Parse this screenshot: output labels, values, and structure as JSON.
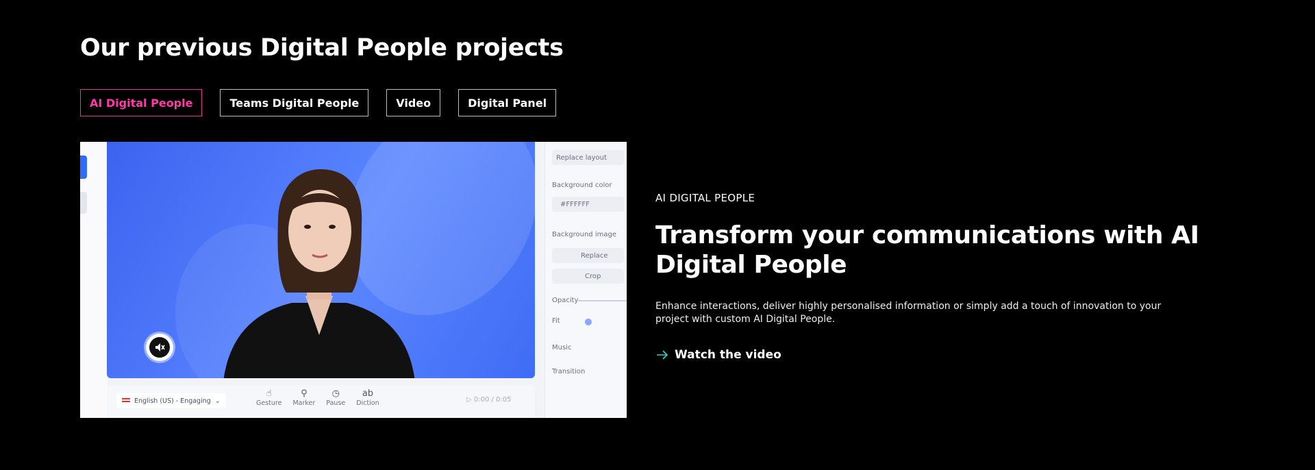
{
  "section": {
    "title": "Our previous Digital People projects"
  },
  "tabs": [
    {
      "label": "AI Digital People",
      "active": true
    },
    {
      "label": "Teams Digital People",
      "active": false
    },
    {
      "label": "Video",
      "active": false
    },
    {
      "label": "Digital Panel",
      "active": false
    }
  ],
  "media": {
    "side_panel": {
      "replace_layout": "Replace layout",
      "background_color_label": "Background color",
      "background_color_value": "#FFFFFF",
      "background_image_label": "Background image",
      "replace_button": "Replace",
      "crop_button": "Crop",
      "opacity_label": "Opacity",
      "fit_label": "Fit",
      "music_label": "Music",
      "transition_label": "Transition"
    },
    "bottom_bar": {
      "language": "English (US) - Engaging",
      "tools": [
        "Gesture",
        "Marker",
        "Pause",
        "Diction"
      ],
      "time": "0:00 / 0:05"
    },
    "colors": {
      "stage": "#4a74f7",
      "accent_pink": "#ff3aa8",
      "arrow_teal": "#2fd6c7"
    }
  },
  "feature": {
    "eyebrow": "AI DIGITAL PEOPLE",
    "heading": "Transform your communications with AI Digital People",
    "description": "Enhance interactions, deliver highly personalised information or simply add a touch of innovation to your project with custom AI Digital People.",
    "cta": "Watch the video"
  }
}
